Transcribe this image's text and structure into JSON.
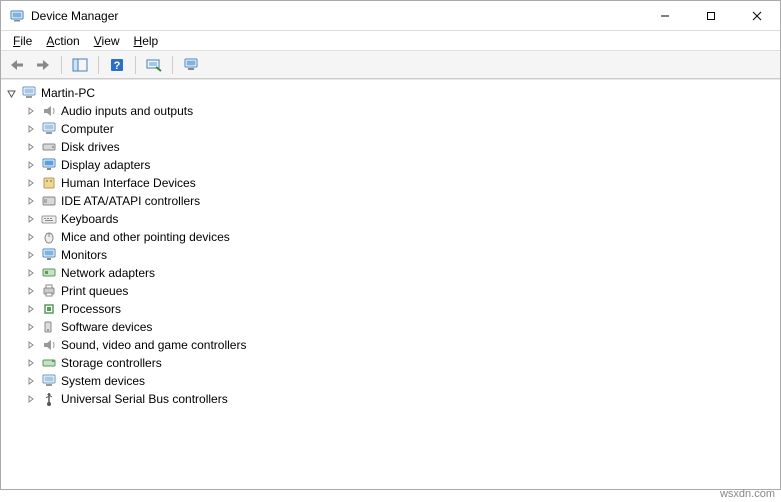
{
  "window": {
    "title": "Device Manager"
  },
  "menubar": {
    "file": "File",
    "action": "Action",
    "view": "View",
    "help": "Help"
  },
  "tree": {
    "root": {
      "label": "Martin-PC",
      "expanded": true
    },
    "items": [
      {
        "label": "Audio inputs and outputs"
      },
      {
        "label": "Computer"
      },
      {
        "label": "Disk drives"
      },
      {
        "label": "Display adapters"
      },
      {
        "label": "Human Interface Devices"
      },
      {
        "label": "IDE ATA/ATAPI controllers"
      },
      {
        "label": "Keyboards"
      },
      {
        "label": "Mice and other pointing devices"
      },
      {
        "label": "Monitors"
      },
      {
        "label": "Network adapters"
      },
      {
        "label": "Print queues"
      },
      {
        "label": "Processors"
      },
      {
        "label": "Software devices"
      },
      {
        "label": "Sound, video and game controllers"
      },
      {
        "label": "Storage controllers"
      },
      {
        "label": "System devices"
      },
      {
        "label": "Universal Serial Bus controllers"
      }
    ]
  },
  "watermark": "wsxdn.com"
}
